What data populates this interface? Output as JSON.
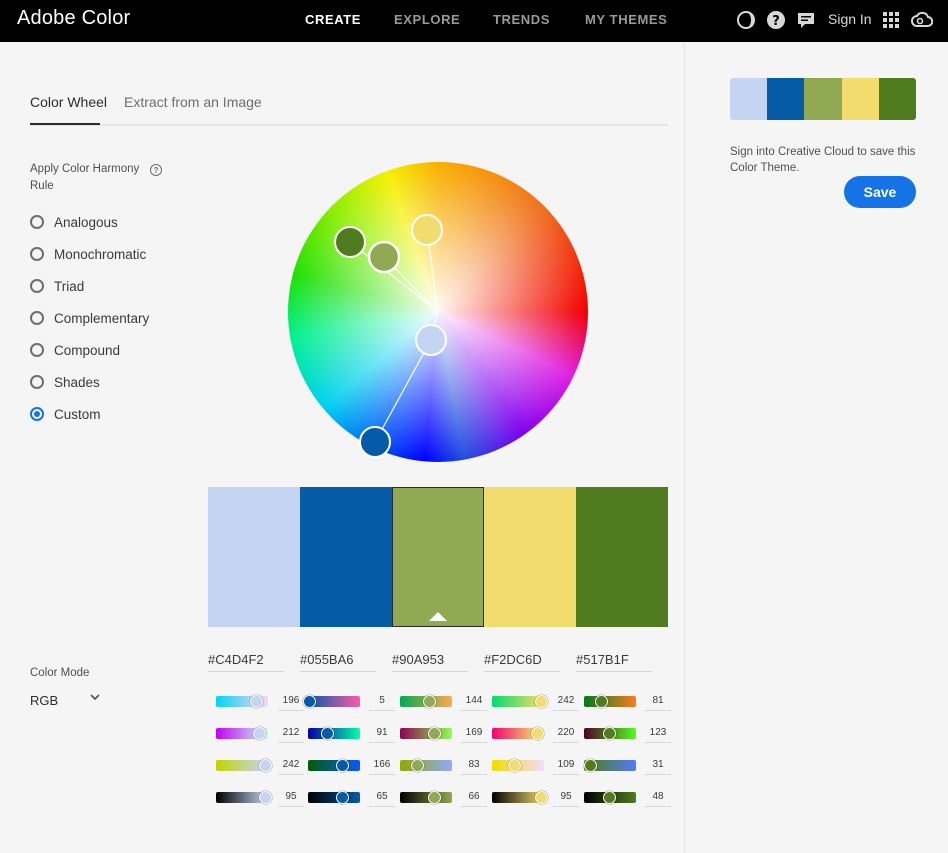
{
  "app": {
    "title": "Adobe Color"
  },
  "nav": {
    "items": [
      {
        "label": "CREATE",
        "active": true
      },
      {
        "label": "EXPLORE",
        "active": false
      },
      {
        "label": "TRENDS",
        "active": false
      },
      {
        "label": "MY THEMES",
        "active": false
      }
    ],
    "signin": "Sign In",
    "icons": [
      "moon-icon",
      "help-icon",
      "chat-icon",
      "apps-grid-icon",
      "creative-cloud-icon"
    ]
  },
  "tabs": [
    {
      "label": "Color Wheel",
      "active": true
    },
    {
      "label": "Extract from an Image",
      "active": false
    }
  ],
  "harmony": {
    "label": "Apply Color Harmony Rule",
    "help": "?",
    "options": [
      {
        "label": "Analogous",
        "selected": false
      },
      {
        "label": "Monochromatic",
        "selected": false
      },
      {
        "label": "Triad",
        "selected": false
      },
      {
        "label": "Complementary",
        "selected": false
      },
      {
        "label": "Compound",
        "selected": false
      },
      {
        "label": "Shades",
        "selected": false
      },
      {
        "label": "Custom",
        "selected": true
      }
    ]
  },
  "theme": {
    "colors": [
      {
        "hex": "#C4D4F2",
        "r": 196,
        "g": 212,
        "b": 242,
        "k": 95
      },
      {
        "hex": "#055BA6",
        "r": 5,
        "g": 91,
        "b": 166,
        "k": 65
      },
      {
        "hex": "#90A953",
        "r": 144,
        "g": 169,
        "b": 83,
        "k": 66
      },
      {
        "hex": "#F2DC6D",
        "r": 242,
        "g": 220,
        "b": 109,
        "k": 95
      },
      {
        "hex": "#517B1F",
        "r": 81,
        "g": 123,
        "b": 31,
        "k": 48
      }
    ],
    "selected_index": 2
  },
  "color_mode": {
    "label": "Color Mode",
    "value": "RGB"
  },
  "right": {
    "note": "Sign into Creative Cloud to save this Color Theme.",
    "save": "Save"
  }
}
